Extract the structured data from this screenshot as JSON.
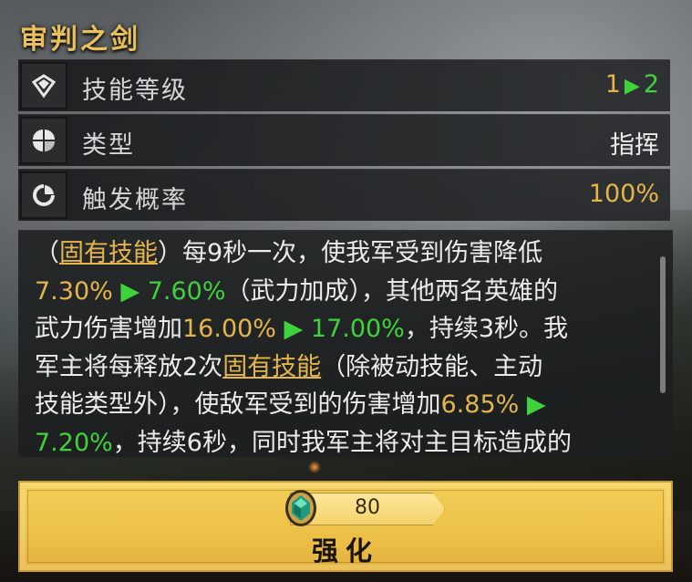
{
  "skill": {
    "title": "审判之剑"
  },
  "stats": [
    {
      "icon": "diamond-rank-icon",
      "label": "技能等级",
      "value_from": "1",
      "arrow": "▶",
      "value_to": "2"
    },
    {
      "icon": "clover-type-icon",
      "label": "类型",
      "value": "指挥"
    },
    {
      "icon": "trigger-gauge-icon",
      "label": "触发概率",
      "value": "100%"
    }
  ],
  "description": {
    "lines": [
      [
        "（",
        {
          "link": "固有技能"
        },
        "）每9秒一次，使我军受到伤害降低"
      ],
      [
        {
          "gold": "7.30%"
        },
        {
          "arrow": " ▶ "
        },
        {
          "green": "7.60%"
        },
        "（武力加成），其他两名英雄的"
      ],
      [
        "武力伤害增加",
        {
          "gold": "16.00%"
        },
        {
          "arrow": " ▶ "
        },
        {
          "green": "17.00%"
        },
        "，持续3秒。我"
      ],
      [
        "军主将每释放2次",
        {
          "link": "固有技能"
        },
        "（除被动技能、主动"
      ],
      [
        "技能类型外），使敌军受到的伤害增加",
        {
          "gold": "6.85%"
        },
        {
          "arrow": " ▶"
        }
      ],
      [
        {
          "green": "7.20%"
        },
        "，持续6秒，同时我军主将对主目标造成的"
      ]
    ]
  },
  "upgrade_button": {
    "cost": "80",
    "label": "强化",
    "gem_icon": "emerald-gem-icon"
  },
  "colors": {
    "gold": "#e5b54a",
    "green": "#3fd23d",
    "button": "#edc24a"
  }
}
